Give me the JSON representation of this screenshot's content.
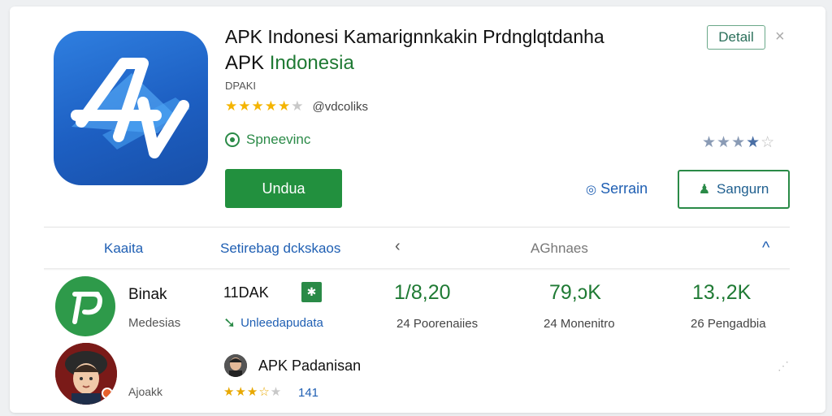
{
  "header": {
    "title_line1": "APK Indonesi Kamarignnkakin Prdnglqtdanha",
    "title_line2_prefix": "APK ",
    "title_line2_brand": "Indonesia",
    "developer": "DPAKI",
    "rating_stars": 4.5,
    "handle": "@vdcoliks",
    "status": "Spneevinc",
    "detail_label": "Detail",
    "close_label": "×",
    "install_label": "Undua",
    "link_label": "Serrain",
    "outline_label": "Sangurn"
  },
  "tabs": {
    "tab1": "Kaaita",
    "tab2": "Setirebag dckskaos",
    "tab3": "AGhnaes",
    "left_chevron": "‹",
    "up_chevron": "^"
  },
  "stats": {
    "row1": {
      "name": "Binak",
      "sub": "Medesias",
      "code": "11DAK",
      "link": "Unleedapudata",
      "stat1_value": "1/8,20",
      "stat1_label": "24 Poorenaiies",
      "stat2_value": "79,ɔK",
      "stat2_label": "24 Monenitro",
      "stat3_value": "13.,2K",
      "stat3_label": "26 Pengadbia"
    },
    "row2": {
      "sub": "Ajoakk",
      "name": "APK Padanisan",
      "stars": 3.5,
      "score": "141"
    }
  },
  "colors": {
    "accent_green": "#22903e",
    "link_blue": "#1f5fb3",
    "star_gold": "#f4b400"
  },
  "icons": [
    "app-logo",
    "radio-status-icon",
    "pin-icon",
    "person-upload-icon",
    "chevron-left-icon",
    "chevron-up-icon",
    "download-arrow-icon",
    "tree-icon"
  ]
}
